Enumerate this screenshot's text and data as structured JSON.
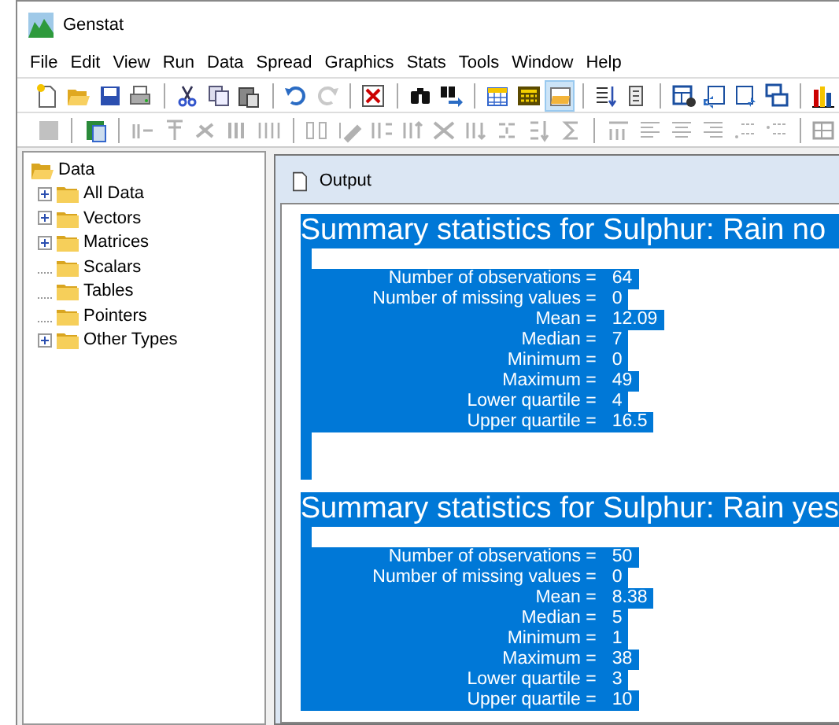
{
  "window": {
    "title": "Genstat"
  },
  "menu": [
    "File",
    "Edit",
    "View",
    "Run",
    "Data",
    "Spread",
    "Graphics",
    "Stats",
    "Tools",
    "Window",
    "Help"
  ],
  "toolbars": [
    [
      {
        "kind": "button",
        "pressed": false,
        "disabled": false
      },
      {
        "kind": "button",
        "pressed": false,
        "disabled": false
      },
      {
        "kind": "button",
        "pressed": false,
        "disabled": false
      },
      {
        "kind": "button",
        "pressed": false,
        "disabled": false
      },
      {
        "kind": "separator"
      },
      {
        "kind": "button",
        "pressed": false,
        "disabled": false
      },
      {
        "kind": "button",
        "pressed": false,
        "disabled": false
      },
      {
        "kind": "button",
        "pressed": false,
        "disabled": false
      },
      {
        "kind": "separator"
      },
      {
        "kind": "button",
        "pressed": false,
        "disabled": false
      },
      {
        "kind": "button",
        "pressed": false,
        "disabled": true
      },
      {
        "kind": "separator"
      },
      {
        "kind": "button",
        "pressed": false,
        "disabled": false
      },
      {
        "kind": "separator"
      },
      {
        "kind": "button",
        "pressed": false,
        "disabled": false
      },
      {
        "kind": "button",
        "pressed": false,
        "disabled": false
      },
      {
        "kind": "separator"
      },
      {
        "kind": "button",
        "pressed": false,
        "disabled": false
      },
      {
        "kind": "button",
        "pressed": false,
        "disabled": false
      },
      {
        "kind": "button",
        "pressed": true,
        "disabled": false
      },
      {
        "kind": "separator"
      },
      {
        "kind": "button",
        "pressed": false,
        "disabled": false
      },
      {
        "kind": "button",
        "pressed": false,
        "disabled": false
      },
      {
        "kind": "separator"
      },
      {
        "kind": "button",
        "pressed": false,
        "disabled": false
      },
      {
        "kind": "button",
        "pressed": false,
        "disabled": false
      },
      {
        "kind": "button",
        "pressed": false,
        "disabled": false
      },
      {
        "kind": "button",
        "pressed": false,
        "disabled": false
      },
      {
        "kind": "separator"
      },
      {
        "kind": "button",
        "pressed": false,
        "disabled": false
      }
    ],
    [
      {
        "kind": "button",
        "pressed": false,
        "disabled": true
      },
      {
        "kind": "separator"
      },
      {
        "kind": "button",
        "pressed": false,
        "disabled": false
      },
      {
        "kind": "separator"
      },
      {
        "kind": "button",
        "pressed": false,
        "disabled": true
      },
      {
        "kind": "button",
        "pressed": false,
        "disabled": true
      },
      {
        "kind": "button",
        "pressed": false,
        "disabled": true
      },
      {
        "kind": "button",
        "pressed": false,
        "disabled": true
      },
      {
        "kind": "button",
        "pressed": false,
        "disabled": true
      },
      {
        "kind": "separator"
      },
      {
        "kind": "button",
        "pressed": false,
        "disabled": true
      },
      {
        "kind": "button",
        "pressed": false,
        "disabled": true
      },
      {
        "kind": "button",
        "pressed": false,
        "disabled": true
      },
      {
        "kind": "button",
        "pressed": false,
        "disabled": true
      },
      {
        "kind": "button",
        "pressed": false,
        "disabled": true
      },
      {
        "kind": "button",
        "pressed": false,
        "disabled": true
      },
      {
        "kind": "button",
        "pressed": false,
        "disabled": true
      },
      {
        "kind": "button",
        "pressed": false,
        "disabled": true
      },
      {
        "kind": "button",
        "pressed": false,
        "disabled": true
      },
      {
        "kind": "separator"
      },
      {
        "kind": "button",
        "pressed": false,
        "disabled": true
      },
      {
        "kind": "button",
        "pressed": false,
        "disabled": true
      },
      {
        "kind": "button",
        "pressed": false,
        "disabled": true
      },
      {
        "kind": "button",
        "pressed": false,
        "disabled": true
      },
      {
        "kind": "button",
        "pressed": false,
        "disabled": true
      },
      {
        "kind": "button",
        "pressed": false,
        "disabled": true
      },
      {
        "kind": "separator"
      },
      {
        "kind": "button",
        "pressed": false,
        "disabled": true
      }
    ]
  ],
  "tree": {
    "label": "Data",
    "expanded": true,
    "children": [
      {
        "label": "All Data",
        "expandable": true
      },
      {
        "label": "Vectors",
        "expandable": true
      },
      {
        "label": "Matrices",
        "expandable": true
      },
      {
        "label": "Scalars",
        "expandable": false
      },
      {
        "label": "Tables",
        "expandable": false
      },
      {
        "label": "Pointers",
        "expandable": false
      },
      {
        "label": "Other Types",
        "expandable": true
      }
    ]
  },
  "output": {
    "title": "Output",
    "sections": [
      {
        "title": "Summary statistics for Sulphur: Rain no",
        "selected": true,
        "rows": [
          {
            "label": "Number of observations =",
            "value": "64"
          },
          {
            "label": "Number of missing values =",
            "value": "0"
          },
          {
            "label": "Mean =",
            "value": "12.09"
          },
          {
            "label": "Median =",
            "value": "7"
          },
          {
            "label": "Minimum =",
            "value": "0"
          },
          {
            "label": "Maximum =",
            "value": "49"
          },
          {
            "label": "Lower quartile =",
            "value": "4"
          },
          {
            "label": "Upper quartile =",
            "value": "16.5"
          }
        ]
      },
      {
        "title": "Summary statistics for Sulphur: Rain yes",
        "selected": true,
        "rows": [
          {
            "label": "Number of observations =",
            "value": "50"
          },
          {
            "label": "Number of missing values =",
            "value": "0"
          },
          {
            "label": "Mean =",
            "value": "8.38"
          },
          {
            "label": "Median =",
            "value": "5"
          },
          {
            "label": "Minimum =",
            "value": "1"
          },
          {
            "label": "Maximum =",
            "value": "38"
          },
          {
            "label": "Lower quartile =",
            "value": "3"
          },
          {
            "label": "Upper quartile =",
            "value": "10"
          }
        ]
      }
    ]
  }
}
